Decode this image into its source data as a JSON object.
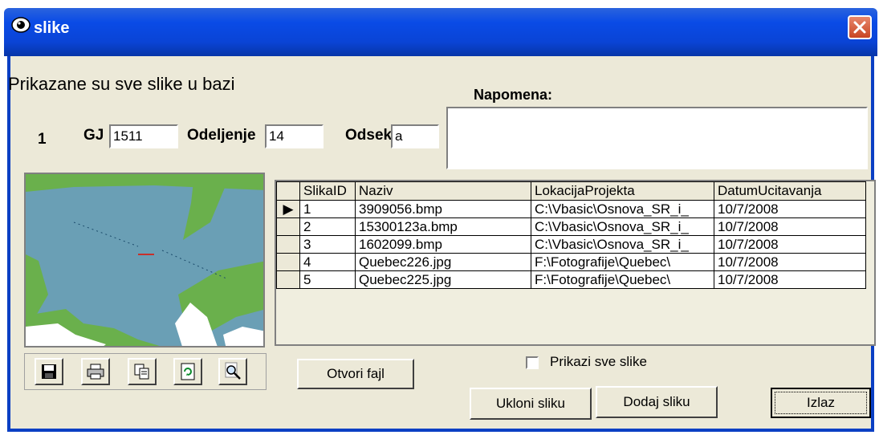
{
  "window": {
    "title": "slike"
  },
  "heading": "Prikazane su sve slike u bazi",
  "record_number": "1",
  "fields": {
    "gj_label": "GJ",
    "gj_value": "1511",
    "odeljenje_label": "Odeljenje",
    "odeljenje_value": "14",
    "odsek_label": "Odsek",
    "odsek_value": "a",
    "napomena_label": "Napomena:",
    "napomena_value": ""
  },
  "table": {
    "columns": [
      "SlikaID",
      "Naziv",
      "LokacijaProjekta",
      "DatumUcitavanja"
    ],
    "rows": [
      [
        "1",
        "3909056.bmp",
        "C:\\Vbasic\\Osnova_SR_i_",
        "10/7/2008"
      ],
      [
        "2",
        "15300123a.bmp",
        "C:\\Vbasic\\Osnova_SR_i_",
        "10/7/2008"
      ],
      [
        "3",
        "1602099.bmp",
        "C:\\Vbasic\\Osnova_SR_i_",
        "10/7/2008"
      ],
      [
        "4",
        "Quebec226.jpg",
        "F:\\Fotografije\\Quebec\\",
        "10/7/2008"
      ],
      [
        "5",
        "Quebec225.jpg",
        "F:\\Fotografije\\Quebec\\",
        "10/7/2008"
      ]
    ],
    "current_row_indicator": "▶"
  },
  "buttons": {
    "open_file": "Otvori fajl",
    "remove_image": "Ukloni sliku",
    "add_image": "Dodaj sliku",
    "exit": "Izlaz"
  },
  "checkbox": {
    "label": "Prikazi sve slike",
    "checked": false
  },
  "toolbar_icons": [
    "save-icon",
    "print-icon",
    "copy-icon",
    "refresh-icon",
    "zoom-icon"
  ],
  "colors": {
    "title_bar": "#0a44d6",
    "dialog_bg": "#ece9d8",
    "map_water": "#6a9fb5",
    "map_land": "#6ab04c"
  }
}
